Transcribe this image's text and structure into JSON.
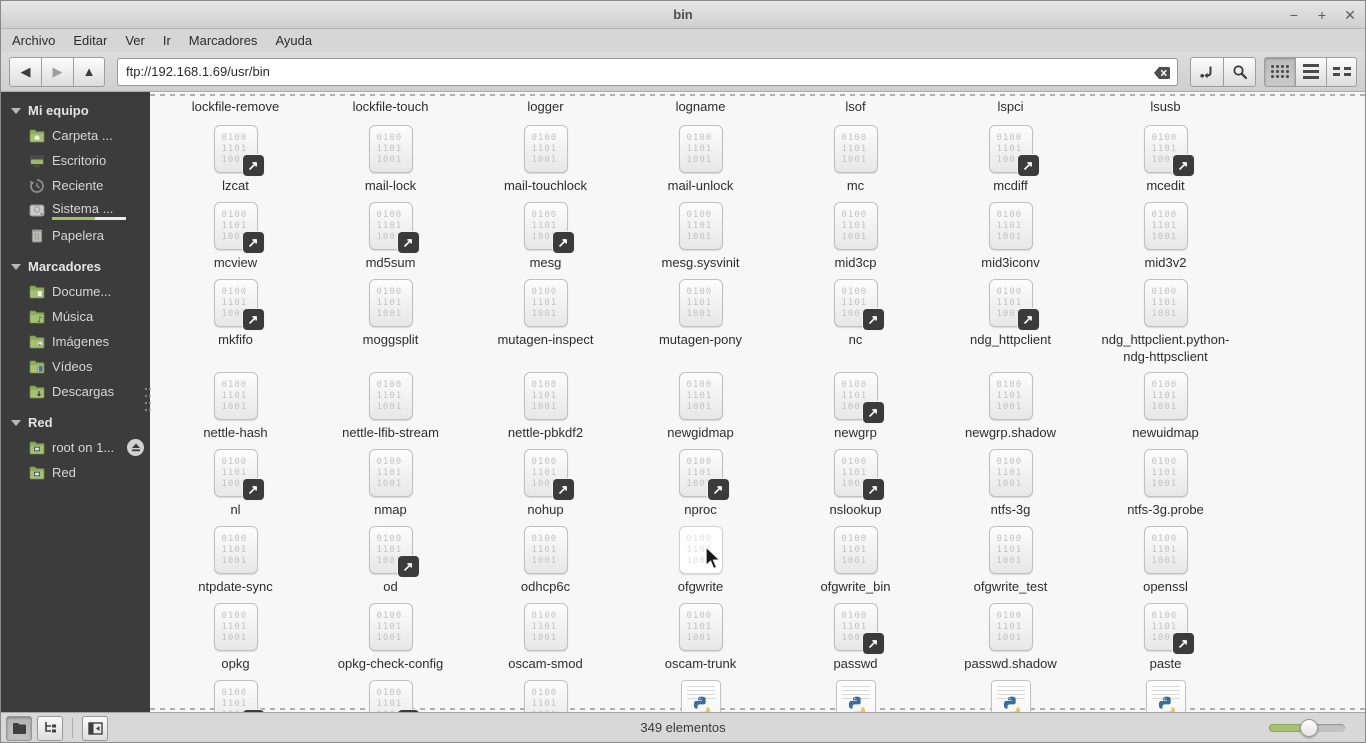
{
  "window": {
    "title": "bin",
    "controls": [
      {
        "name": "minimize",
        "glyph": "−"
      },
      {
        "name": "maximize",
        "glyph": "+"
      },
      {
        "name": "close",
        "glyph": "✕"
      }
    ]
  },
  "menubar": {
    "items": [
      "Archivo",
      "Editar",
      "Ver",
      "Ir",
      "Marcadores",
      "Ayuda"
    ]
  },
  "toolbar": {
    "location_value": "ftp://192.168.1.69/usr/bin"
  },
  "sidebar": {
    "sections": [
      {
        "label": "Mi equipo",
        "items": [
          {
            "label": "Carpeta ...",
            "icon": "home-folder-icon"
          },
          {
            "label": "Escritorio",
            "icon": "desktop-icon"
          },
          {
            "label": "Reciente",
            "icon": "recent-icon"
          },
          {
            "label": "Sistema ...",
            "icon": "disk-icon",
            "selected": true,
            "usage": 0.58
          },
          {
            "label": "Papelera",
            "icon": "trash-icon"
          }
        ]
      },
      {
        "label": "Marcadores",
        "items": [
          {
            "label": "Docume...",
            "icon": "documents-folder-icon"
          },
          {
            "label": "Música",
            "icon": "music-folder-icon"
          },
          {
            "label": "Imágenes",
            "icon": "pictures-folder-icon"
          },
          {
            "label": "Vídeos",
            "icon": "videos-folder-icon"
          },
          {
            "label": "Descargas",
            "icon": "downloads-folder-icon"
          }
        ]
      },
      {
        "label": "Red",
        "items": [
          {
            "label": "root on 1...",
            "icon": "remote-folder-icon",
            "eject": true
          },
          {
            "label": "Red",
            "icon": "network-folder-icon"
          }
        ]
      }
    ]
  },
  "grid": {
    "binary_glyph_lines": [
      "0100",
      "1101",
      "1001"
    ],
    "top_labels": [
      "lockfile-remove",
      "lockfile-touch",
      "logger",
      "logname",
      "lsof",
      "lspci",
      "lsusb"
    ],
    "rows": [
      [
        {
          "label": "lzcat",
          "link": true
        },
        {
          "label": "mail-lock"
        },
        {
          "label": "mail-touchlock"
        },
        {
          "label": "mail-unlock"
        },
        {
          "label": "mc"
        },
        {
          "label": "mcdiff",
          "link": true
        },
        {
          "label": "mcedit",
          "link": true
        }
      ],
      [
        {
          "label": "mcview",
          "link": true
        },
        {
          "label": "md5sum",
          "link": true
        },
        {
          "label": "mesg",
          "link": true
        },
        {
          "label": "mesg.sysvinit"
        },
        {
          "label": "mid3cp"
        },
        {
          "label": "mid3iconv"
        },
        {
          "label": "mid3v2"
        }
      ],
      [
        {
          "label": "mkfifo",
          "link": true
        },
        {
          "label": "moggsplit"
        },
        {
          "label": "mutagen-inspect"
        },
        {
          "label": "mutagen-pony"
        },
        {
          "label": "nc",
          "link": true
        },
        {
          "label": "ndg_httpclient",
          "link": true
        },
        {
          "label": "ndg_httpclient.python-ndg-httpsclient"
        }
      ],
      [
        {
          "label": "nettle-hash"
        },
        {
          "label": "nettle-lfib-stream"
        },
        {
          "label": "nettle-pbkdf2"
        },
        {
          "label": "newgidmap"
        },
        {
          "label": "newgrp",
          "link": true
        },
        {
          "label": "newgrp.shadow"
        },
        {
          "label": "newuidmap"
        }
      ],
      [
        {
          "label": "nl",
          "link": true
        },
        {
          "label": "nmap"
        },
        {
          "label": "nohup",
          "link": true
        },
        {
          "label": "nproc",
          "link": true
        },
        {
          "label": "nslookup",
          "link": true
        },
        {
          "label": "ntfs-3g"
        },
        {
          "label": "ntfs-3g.probe"
        }
      ],
      [
        {
          "label": "ntpdate-sync"
        },
        {
          "label": "od",
          "link": true
        },
        {
          "label": "odhcp6c"
        },
        {
          "label": "ofgwrite",
          "hover": true
        },
        {
          "label": "ofgwrite_bin"
        },
        {
          "label": "ofgwrite_test"
        },
        {
          "label": "openssl"
        }
      ],
      [
        {
          "label": "opkg"
        },
        {
          "label": "opkg-check-config"
        },
        {
          "label": "oscam-smod"
        },
        {
          "label": "oscam-trunk"
        },
        {
          "label": "passwd",
          "link": true
        },
        {
          "label": "passwd.shadow"
        },
        {
          "label": "paste",
          "link": true
        }
      ],
      [
        {
          "label": "",
          "link": true
        },
        {
          "label": "",
          "link": true
        },
        {
          "label": ""
        },
        {
          "label": "",
          "type": "py"
        },
        {
          "label": "",
          "type": "py"
        },
        {
          "label": "",
          "type": "py"
        },
        {
          "label": "",
          "type": "py"
        }
      ]
    ]
  },
  "statusbar": {
    "text": "349 elementos",
    "zoom_fraction": 0.53
  },
  "colors": {
    "accent_green": "#a4c162",
    "sidebar_bg": "#3c3c3c",
    "chrome_gray": "#d6d6d6",
    "python_blue": "#376f9e",
    "python_yellow": "#efc44d"
  }
}
